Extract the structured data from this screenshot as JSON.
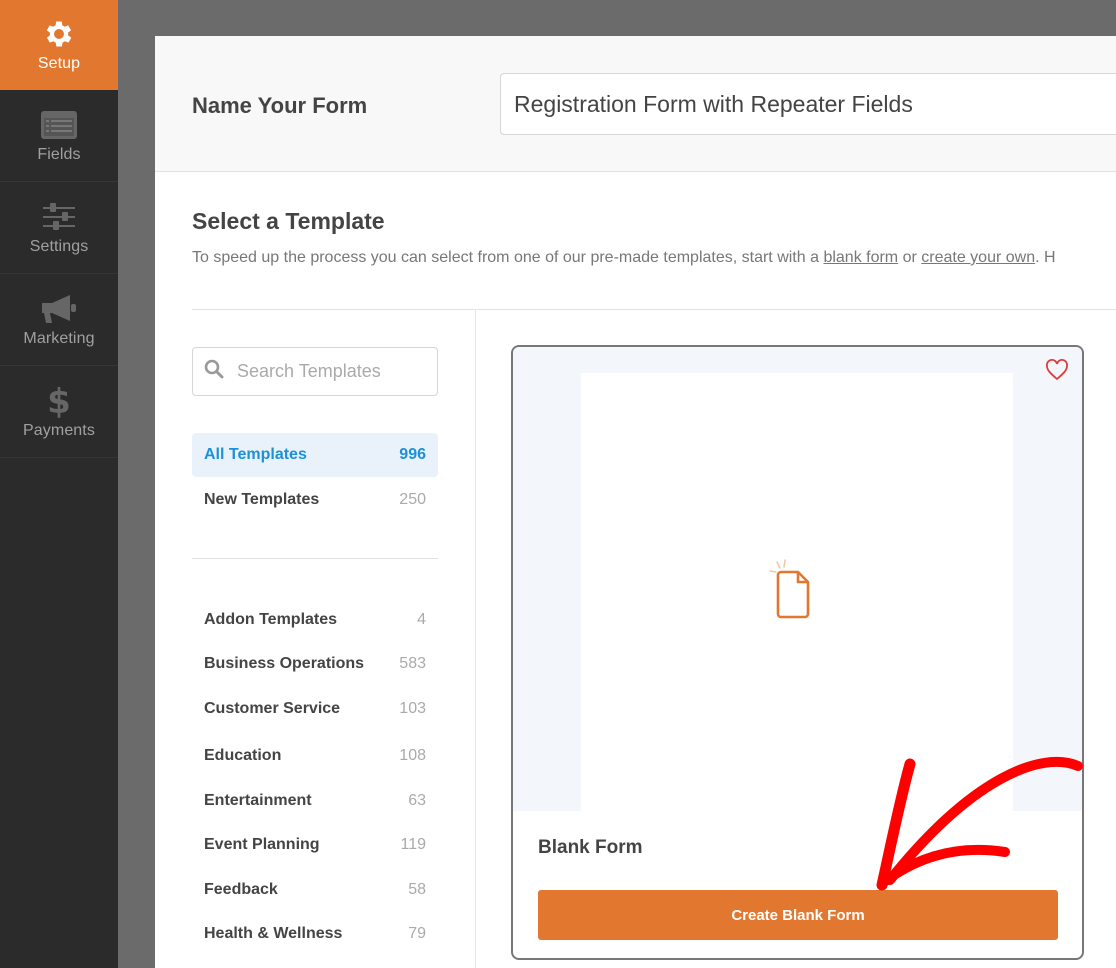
{
  "sidebar": {
    "items": [
      {
        "label": "Setup",
        "icon": "gear-icon",
        "active": true
      },
      {
        "label": "Fields",
        "icon": "fields-list-icon",
        "active": false
      },
      {
        "label": "Settings",
        "icon": "sliders-icon",
        "active": false
      },
      {
        "label": "Marketing",
        "icon": "megaphone-icon",
        "active": false
      },
      {
        "label": "Payments",
        "icon": "dollar-icon",
        "active": false
      }
    ]
  },
  "form_name": {
    "label": "Name Your Form",
    "value": "Registration Form with Repeater Fields"
  },
  "template_section": {
    "title": "Select a Template",
    "description_prefix": "To speed up the process you can select from one of our pre-made templates, start with a ",
    "blank_form_link": "blank form",
    "description_middle": " or ",
    "create_own_link": "create your own",
    "description_suffix": ". H"
  },
  "search": {
    "placeholder": "Search Templates",
    "value": ""
  },
  "categories_top": [
    {
      "name": "All Templates",
      "count": "996",
      "active": true
    },
    {
      "name": "New Templates",
      "count": "250",
      "active": false
    }
  ],
  "categories": [
    {
      "name": "Addon Templates",
      "count": "4"
    },
    {
      "name": "Business Operations",
      "count": "583"
    },
    {
      "name": "Customer Service",
      "count": "103"
    },
    {
      "name": "Education",
      "count": "108"
    },
    {
      "name": "Entertainment",
      "count": "63"
    },
    {
      "name": "Event Planning",
      "count": "119"
    },
    {
      "name": "Feedback",
      "count": "58"
    },
    {
      "name": "Health & Wellness",
      "count": "79"
    }
  ],
  "card": {
    "title": "Blank Form",
    "button_label": "Create Blank Form",
    "favorite": false
  },
  "colors": {
    "accent": "#e27730",
    "sidebar_bg": "#2b2b2b",
    "active_category": "#1d91d8",
    "favorite": "#e03c3c",
    "annotation_arrow": "#ff0000"
  }
}
